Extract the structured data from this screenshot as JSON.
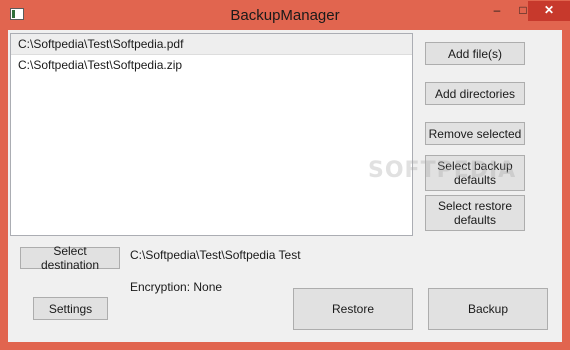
{
  "window": {
    "title": "BackupManager",
    "controls": {
      "minimize": "–",
      "maximize": "□",
      "close": "✕"
    }
  },
  "file_list": {
    "items": [
      "C:\\Softpedia\\Test\\Softpedia.pdf",
      "C:\\Softpedia\\Test\\Softpedia.zip"
    ],
    "selected_index": 0
  },
  "side_buttons": {
    "add_files": "Add file(s)",
    "add_directories": "Add directories",
    "remove_selected": "Remove selected",
    "select_backup_defaults": [
      "Select backup",
      "defaults"
    ],
    "select_restore_defaults": [
      "Select restore",
      "defaults"
    ]
  },
  "destination": {
    "button_label": "Select destination",
    "path": "C:\\Softpedia\\Test\\Softpedia Test"
  },
  "encryption_label": "Encryption: None",
  "bottom_buttons": {
    "settings": "Settings",
    "restore": "Restore",
    "backup": "Backup"
  },
  "watermark": "SOFTPEDIA",
  "colors": {
    "frame": "#e1654f",
    "client_bg": "#f0f0f0",
    "button_bg": "#e1e1e1",
    "button_border": "#adadad",
    "close_button": "#c7392c"
  }
}
